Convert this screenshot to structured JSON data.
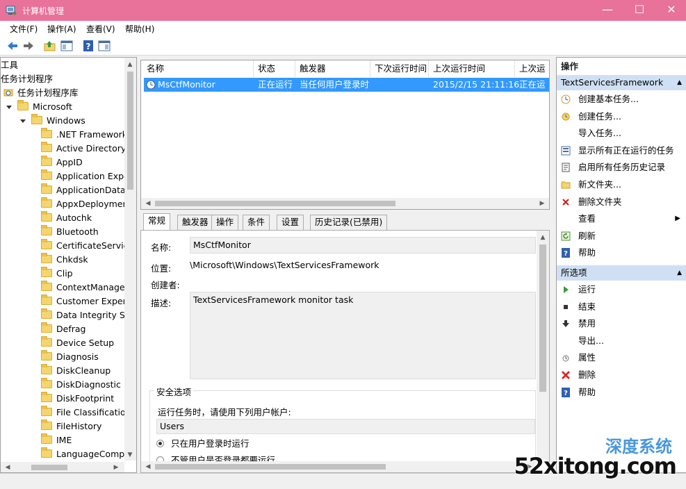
{
  "window": {
    "title": "计算机管理",
    "minimize_glyph": "—",
    "maximize_glyph": "☐",
    "close_glyph": "✕"
  },
  "menu": [
    "文件(F)",
    "操作(A)",
    "查看(V)",
    "帮助(H)"
  ],
  "toolbar_icons": [
    "back-arrow-icon",
    "forward-arrow-icon",
    "up-folder-icon",
    "show-hide-tree-icon",
    "help-icon",
    "show-hide-action-pane-icon"
  ],
  "tree": {
    "items": [
      {
        "label": "工具",
        "level": 0
      },
      {
        "label": "任务计划程序",
        "level": 0
      },
      {
        "label": "任务计划程序库",
        "level": 0
      },
      {
        "label": "Microsoft",
        "level": 1
      },
      {
        "label": "Windows",
        "level": 2
      },
      {
        "label": ".NET Framework",
        "level": 3
      },
      {
        "label": "Active Directory",
        "level": 3
      },
      {
        "label": "AppID",
        "level": 3
      },
      {
        "label": "Application Expe",
        "level": 3
      },
      {
        "label": "ApplicationData",
        "level": 3
      },
      {
        "label": "AppxDeploymen",
        "level": 3
      },
      {
        "label": "Autochk",
        "level": 3
      },
      {
        "label": "Bluetooth",
        "level": 3
      },
      {
        "label": "CertificateService",
        "level": 3
      },
      {
        "label": "Chkdsk",
        "level": 3
      },
      {
        "label": "Clip",
        "level": 3
      },
      {
        "label": "ContextManager",
        "level": 3
      },
      {
        "label": "Customer Experi",
        "level": 3
      },
      {
        "label": "Data Integrity Sc",
        "level": 3
      },
      {
        "label": "Defrag",
        "level": 3
      },
      {
        "label": "Device Setup",
        "level": 3
      },
      {
        "label": "Diagnosis",
        "level": 3
      },
      {
        "label": "DiskCleanup",
        "level": 3
      },
      {
        "label": "DiskDiagnostic",
        "level": 3
      },
      {
        "label": "DiskFootprint",
        "level": 3
      },
      {
        "label": "File Classificatior",
        "level": 3
      },
      {
        "label": "FileHistory",
        "level": 3
      },
      {
        "label": "IME",
        "level": 3
      },
      {
        "label": "LanguageCompo",
        "level": 3
      }
    ]
  },
  "task_list": {
    "columns": [
      "名称",
      "状态",
      "触发器",
      "下次运行时间",
      "上次运行时间",
      "上次运"
    ],
    "rows": [
      {
        "name": "MsCtfMonitor",
        "status": "正在运行",
        "trigger": "当任何用户登录时",
        "next_run": "",
        "last_run": "2015/2/15 21:11:16",
        "last_result": "正在运"
      }
    ]
  },
  "tabs": [
    "常规",
    "触发器",
    "操作",
    "条件",
    "设置",
    "历史记录(已禁用)"
  ],
  "general": {
    "name_label": "名称:",
    "name_value": "MsCtfMonitor",
    "location_label": "位置:",
    "location_value": "\\Microsoft\\Windows\\TextServicesFramework",
    "author_label": "创建者:",
    "desc_label": "描述:",
    "desc_value": "TextServicesFramework monitor task",
    "security_title": "安全选项",
    "run_as_label": "运行任务时，请使用下列用户帐户:",
    "run_as_value": "Users",
    "radio1": "只在用户登录时运行",
    "radio2": "不管用户是否登录都要运行"
  },
  "actions": {
    "header": "操作",
    "section1_title": "TextServicesFramework",
    "section1_items": [
      {
        "icon": "create-basic-task-icon",
        "label": "创建基本任务..."
      },
      {
        "icon": "create-task-icon",
        "label": "创建任务..."
      },
      {
        "icon": "",
        "label": "导入任务..."
      },
      {
        "icon": "show-running-tasks-icon",
        "label": "显示所有正在运行的任务"
      },
      {
        "icon": "enable-history-icon",
        "label": "启用所有任务历史记录"
      },
      {
        "icon": "new-folder-icon",
        "label": "新文件夹..."
      },
      {
        "icon": "delete-folder-icon",
        "label": "删除文件夹"
      },
      {
        "icon": "",
        "label": "查看",
        "submenu": true
      },
      {
        "icon": "refresh-icon",
        "label": "刷新"
      },
      {
        "icon": "help-icon",
        "label": "帮助"
      }
    ],
    "section2_title": "所选项",
    "section2_items": [
      {
        "icon": "run-icon",
        "label": "运行"
      },
      {
        "icon": "end-icon",
        "label": "结束"
      },
      {
        "icon": "disable-icon",
        "label": "禁用"
      },
      {
        "icon": "",
        "label": "导出..."
      },
      {
        "icon": "properties-icon",
        "label": "属性"
      },
      {
        "icon": "delete-icon",
        "label": "删除"
      },
      {
        "icon": "help-icon",
        "label": "帮助"
      }
    ]
  },
  "watermark": {
    "text": "52xitong.com",
    "top_text": "深度系统"
  },
  "colors": {
    "titlebar": "#e8729a",
    "selection": "#3399ff",
    "section_header": "#cfe0f4"
  }
}
